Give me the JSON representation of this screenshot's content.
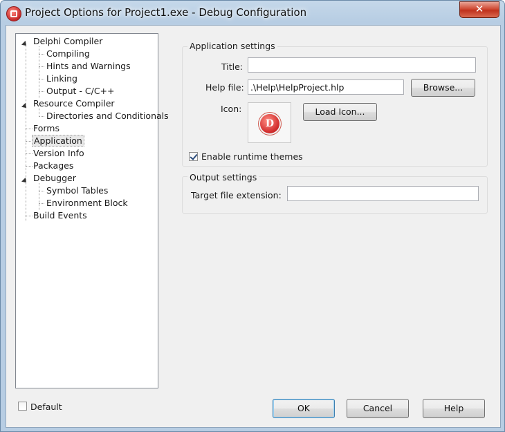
{
  "window": {
    "title": "Project Options for Project1.exe - Debug Configuration",
    "close_glyph": "✕"
  },
  "tree": {
    "nodes": [
      {
        "label": "Delphi Compiler"
      },
      {
        "label": "Compiling"
      },
      {
        "label": "Hints and Warnings"
      },
      {
        "label": "Linking"
      },
      {
        "label": "Output - C/C++"
      },
      {
        "label": "Resource Compiler"
      },
      {
        "label": "Directories and Conditionals"
      },
      {
        "label": "Forms"
      },
      {
        "label": "Application",
        "selected": true
      },
      {
        "label": "Version Info"
      },
      {
        "label": "Packages"
      },
      {
        "label": "Debugger"
      },
      {
        "label": "Symbol Tables"
      },
      {
        "label": "Environment Block"
      },
      {
        "label": "Build Events"
      }
    ]
  },
  "application_settings": {
    "group_title": "Application settings",
    "title_label": "Title:",
    "title_value": "",
    "helpfile_label": "Help file:",
    "helpfile_value": ".\\Help\\HelpProject.hlp",
    "browse_label": "Browse...",
    "icon_label": "Icon:",
    "icon_glyph": "D",
    "load_icon_label": "Load Icon...",
    "runtime_themes_label": "Enable runtime themes",
    "runtime_themes_checked": true
  },
  "output_settings": {
    "group_title": "Output settings",
    "target_ext_label": "Target file extension:",
    "target_ext_value": ""
  },
  "footer": {
    "default_label": "Default",
    "default_checked": false,
    "ok_label": "OK",
    "cancel_label": "Cancel",
    "help_label": "Help"
  }
}
